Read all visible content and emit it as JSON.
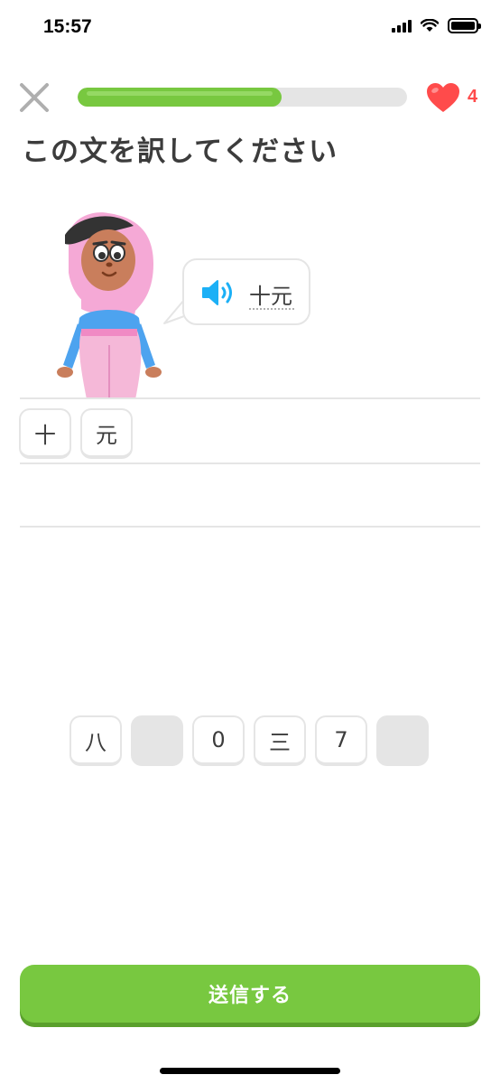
{
  "status_bar": {
    "time": "15:57"
  },
  "header": {
    "progress_percent": 62,
    "hearts": "4"
  },
  "prompt": {
    "title": "この文を訳してください"
  },
  "bubble": {
    "text": "十元"
  },
  "answer_tiles": [
    "十",
    "元"
  ],
  "word_bank": [
    "八",
    "",
    "0",
    "三",
    "7",
    ""
  ],
  "submit": {
    "label": "送信する"
  },
  "colors": {
    "accent_green": "#78c840",
    "heart_red": "#ff4b4b",
    "speaker_blue": "#1cb0f6"
  }
}
